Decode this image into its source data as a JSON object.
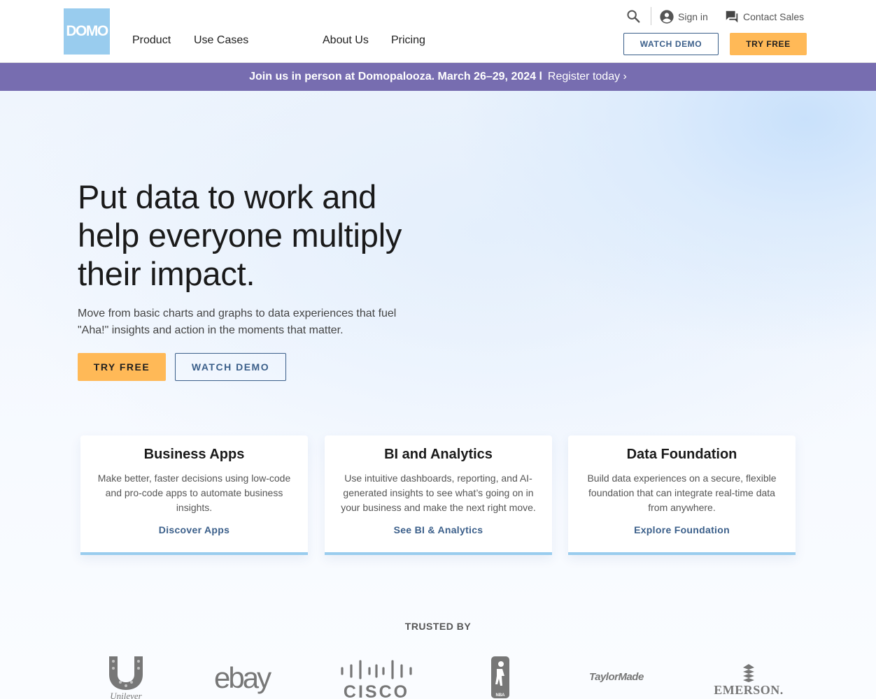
{
  "header": {
    "logo_text": "DOMO",
    "nav": [
      "Product",
      "Use Cases",
      "About Us",
      "Pricing"
    ],
    "sign_in": "Sign in",
    "contact_sales": "Contact Sales",
    "watch_demo": "WATCH DEMO",
    "try_free": "TRY FREE"
  },
  "banner": {
    "text": "Join us in person at Domopalooza. March 26–29, 2024 l",
    "link": "Register today ›"
  },
  "hero": {
    "title_lines": [
      "Put data to work and",
      "help everyone multiply",
      "their impact."
    ],
    "subtitle_lines": [
      "Move from basic charts and graphs to data experiences that fuel",
      "\"Aha!\" insights and action in the moments that matter."
    ],
    "try_free": "TRY FREE",
    "watch_demo": "WATCH DEMO"
  },
  "cards": [
    {
      "title": "Business Apps",
      "body": "Make better, faster decisions using low-code and pro-code apps to automate business insights.",
      "link": "Discover Apps"
    },
    {
      "title": "BI and Analytics",
      "body": "Use intuitive dashboards, reporting, and AI-generated insights to see what’s going on in your business and make the next right move.",
      "link": "See BI & Analytics"
    },
    {
      "title": "Data Foundation",
      "body": "Build data experiences on a secure, flexible foundation that can integrate real-time data from anywhere.",
      "link": "Explore Foundation"
    }
  ],
  "trusted": {
    "label": "TRUSTED BY",
    "logos": [
      "Unilever",
      "ebay",
      "CISCO",
      "NBA",
      "TaylorMade",
      "EMERSON."
    ]
  },
  "colors": {
    "brand_blue": "#99ccee",
    "banner_purple": "#776db0",
    "cta_orange": "#ffb957",
    "link_blue": "#3b5f8a"
  }
}
